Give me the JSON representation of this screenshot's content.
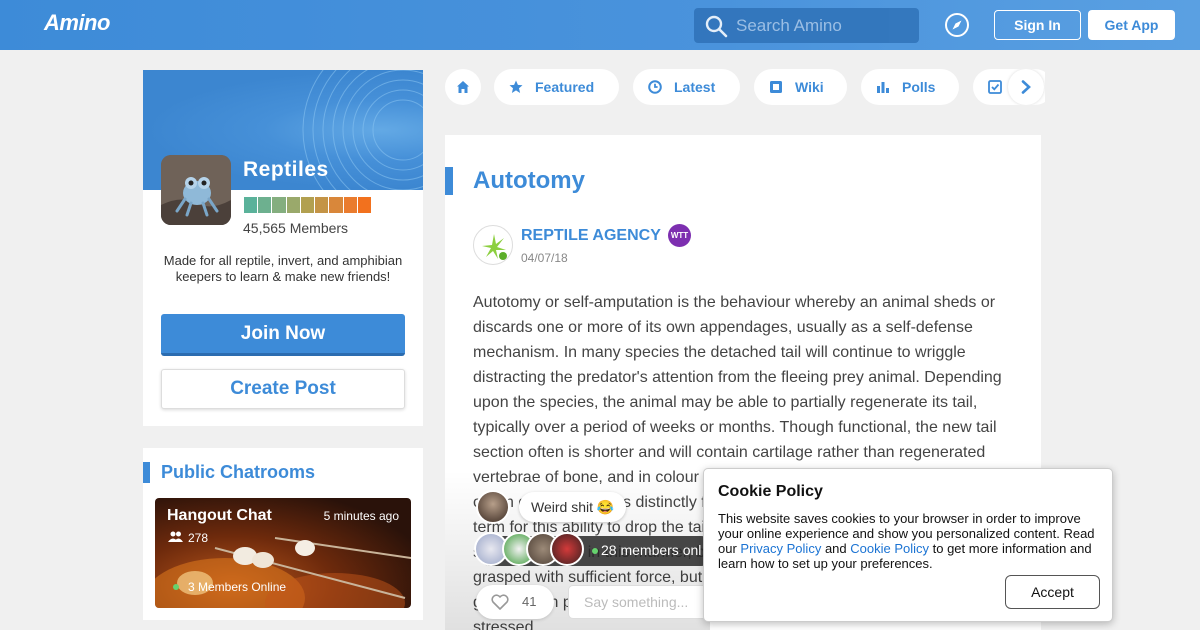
{
  "header": {
    "logo": "Amino",
    "search_placeholder": "Search Amino",
    "signin_label": "Sign In",
    "getapp_label": "Get App"
  },
  "community": {
    "name": "Reptiles",
    "members": "45,565 Members",
    "description": "Made for all reptile, invert, and amphibian keepers to learn & make new friends!",
    "join_label": "Join Now",
    "create_label": "Create Post",
    "level_colors": [
      "#5ab29a",
      "#6db08f",
      "#84ae7f",
      "#9aa96b",
      "#b2a050",
      "#c49446",
      "#d9873a",
      "#ea7c2e",
      "#f2711e"
    ]
  },
  "chatrooms": {
    "title": "Public Chatrooms",
    "items": [
      {
        "name": "Hangout Chat",
        "time": "5 minutes ago",
        "count": "278",
        "online": "3 Members Online"
      }
    ]
  },
  "nav": {
    "tabs": [
      {
        "label": "Featured",
        "icon": "star-icon"
      },
      {
        "label": "Latest",
        "icon": "clock-icon"
      },
      {
        "label": "Wiki",
        "icon": "wiki-icon"
      },
      {
        "label": "Polls",
        "icon": "poll-icon"
      },
      {
        "label": "",
        "icon": "checklist-icon"
      }
    ]
  },
  "post": {
    "title": "Autotomy",
    "author": "REPTILE AGENCY",
    "badge": "WTT",
    "date": "04/07/18",
    "body": "Autotomy or self-amputation is the behaviour whereby an animal sheds or discards one or more of its own appendages, usually as a self-defense mechanism. In many species the detached tail will continue to wriggle distracting the predator's attention from the fleeing prey animal. Depending upon the species, the animal may be able to partially regenerate its tail, typically over a period of weeks or months. Though functional, the new tail section often is shorter and will contain cartilage rather than regenerated vertebrae of bone, and in colour and texture the skin of the regenerated organ generally differs distinctly from its original appearance. The technical term for this ability to drop the tail is 'caudal autotomy'. In most lizards that sacrifice the tail in this manner, breakage occurs only when the tail is grasped with sufficient force, but some animals, such as some species of geckos, can perform true autotomy, throwing off the tail when sufficiently stressed."
  },
  "live_chat": {
    "message": "Weird shit 😂",
    "online_text": "28 members onl",
    "likes": "41",
    "say_placeholder": "Say something..."
  },
  "cookie": {
    "title": "Cookie Policy",
    "text_1": "This website saves cookies to your browser in order to improve your online experience and show you personalized content. Read our ",
    "link_privacy": "Privacy Policy",
    "text_2": " and ",
    "link_cookie": "Cookie Policy",
    "text_3": " to get more information and learn how to set up your preferences.",
    "accept_label": "Accept"
  }
}
